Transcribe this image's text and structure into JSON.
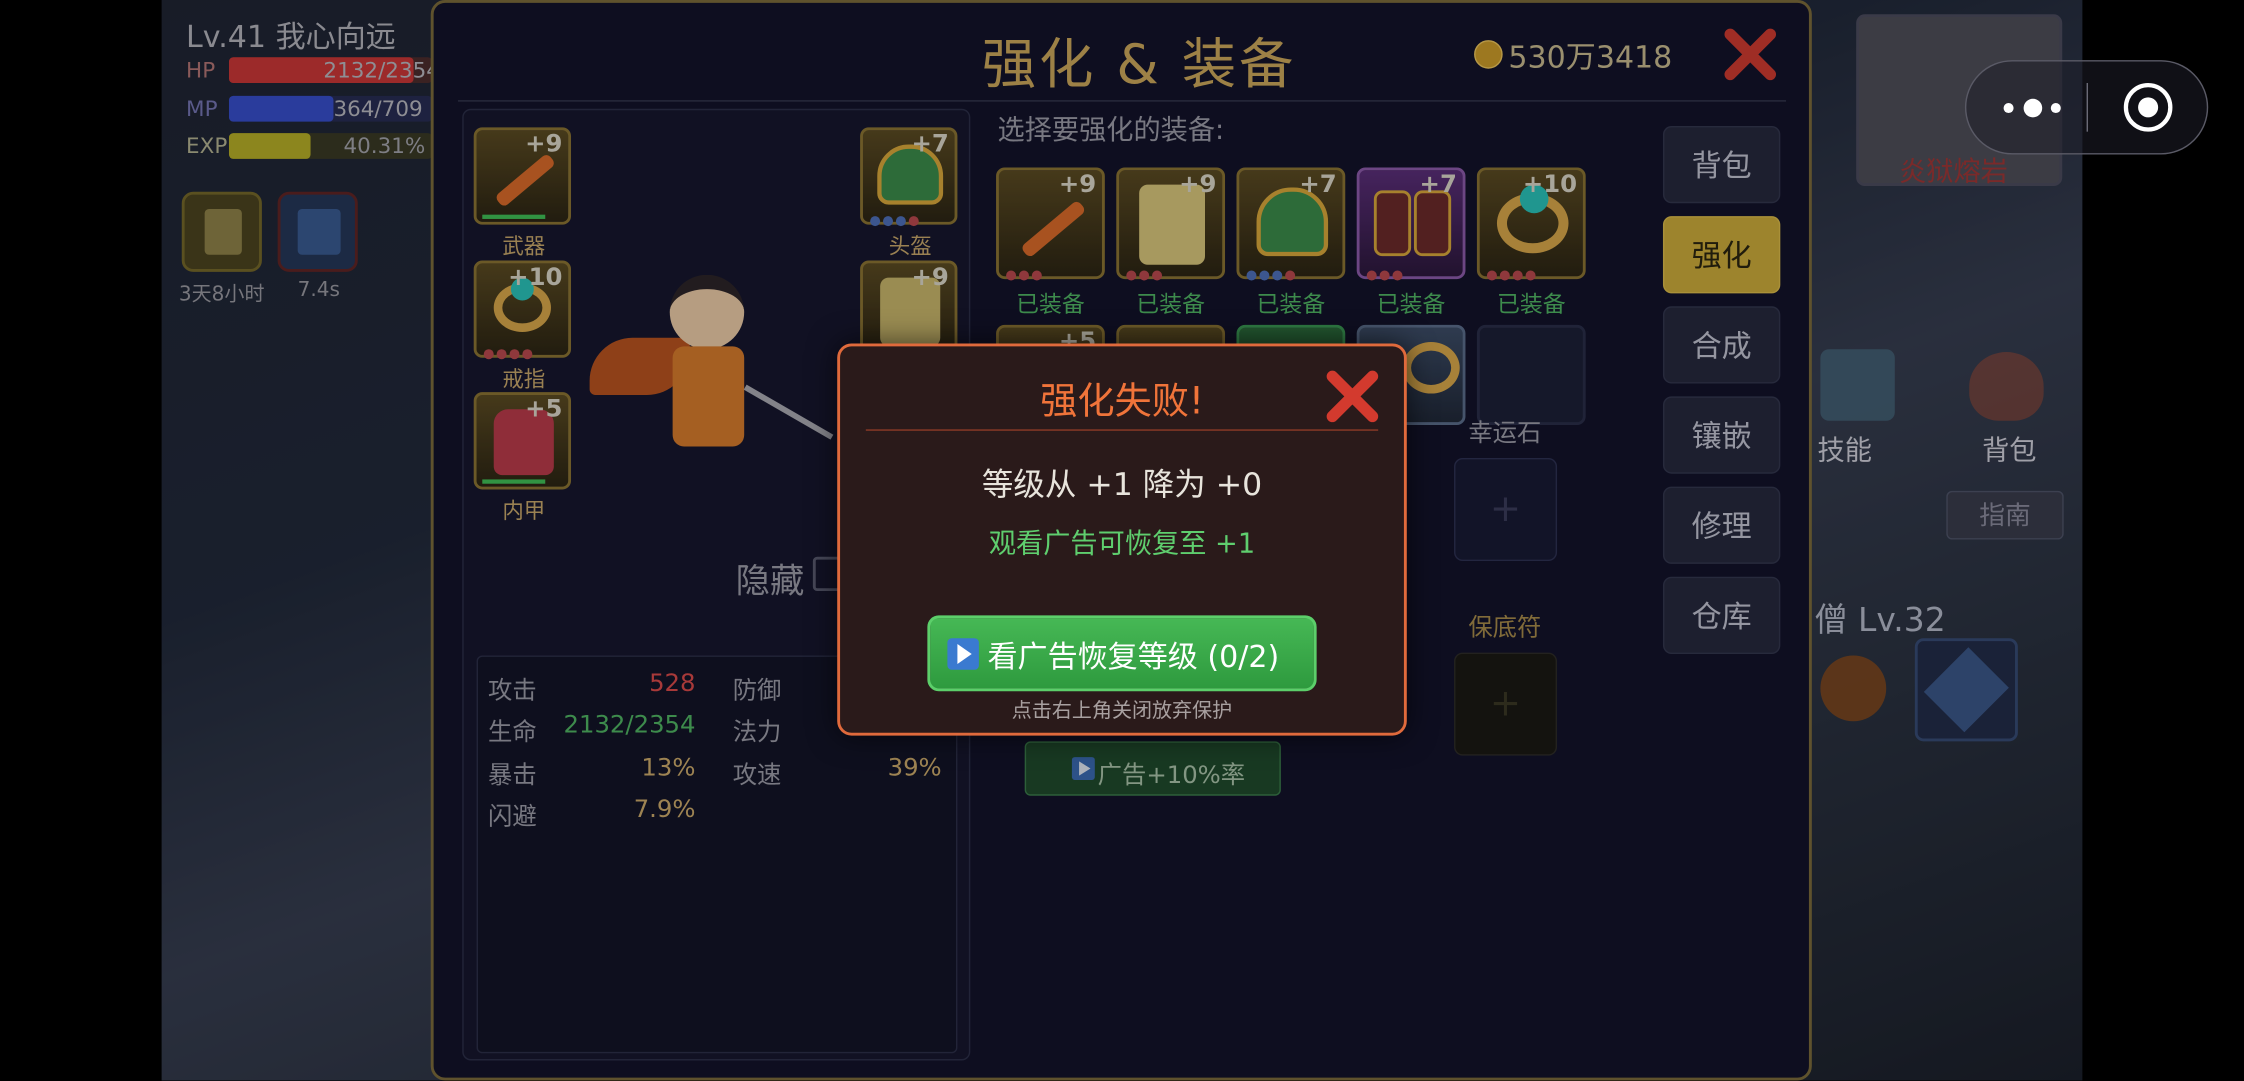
{
  "hud": {
    "player_name": "Lv.41 我心向远",
    "hp_label": "HP",
    "hp_value": "2132/2354",
    "hp_fraction": 0.906,
    "mp_label": "MP",
    "mp_value": "364/709",
    "mp_fraction": 0.513,
    "exp_label": "EXP",
    "exp_value": "40.31%",
    "exp_fraction": 0.4031,
    "buffs": [
      {
        "timer": "3天8小时"
      },
      {
        "timer": "7.4s"
      }
    ],
    "map_name": "炎狱熔岩",
    "right_skill_label": "技能",
    "right_bag_label": "背包",
    "guide_label": "指南",
    "monster_label": "僧 Lv.32"
  },
  "miniprogram": {
    "more_icon": "more-dots-icon",
    "close_icon": "target-circle-icon"
  },
  "panel": {
    "title": "强化 & 装备",
    "gold": "530万3418",
    "select_prompt": "选择要强化的装备:",
    "slots": [
      {
        "label": "武器",
        "level": "+9",
        "icon": "sword-icon"
      },
      {
        "label": "戒指",
        "level": "+10",
        "icon": "ring-icon"
      },
      {
        "label": "内甲",
        "level": "+5",
        "icon": "armor-icon"
      },
      {
        "label": "头盔",
        "level": "+7",
        "icon": "helmet-icon"
      },
      {
        "level": "+9",
        "icon": "robe-icon"
      }
    ],
    "hide_label": "隐藏",
    "stats": [
      {
        "name": "攻击",
        "value": "528",
        "color": "#e05050"
      },
      {
        "name": "防御",
        "value": ""
      },
      {
        "name": "生命",
        "value": "2132/2354",
        "color": "#4fc262"
      },
      {
        "name": "法力",
        "value": ""
      },
      {
        "name": "暴击",
        "value": "13%",
        "color": "#d9b56a"
      },
      {
        "name": "攻速",
        "value": "39%",
        "color": "#d9b56a"
      },
      {
        "name": "闪避",
        "value": "7.9%",
        "color": "#d9b56a"
      }
    ],
    "equipped_grid": [
      {
        "level": "+9",
        "status": "已装备",
        "icon": "sword-icon"
      },
      {
        "level": "+9",
        "status": "已装备",
        "icon": "robe-icon"
      },
      {
        "level": "+7",
        "status": "已装备",
        "icon": "helmet-icon"
      },
      {
        "level": "+7",
        "status": "已装备",
        "icon": "boots-icon"
      },
      {
        "level": "+10",
        "status": "已装备",
        "icon": "ring-icon"
      }
    ],
    "second_row": [
      {
        "level": "+5"
      },
      {},
      {},
      {},
      {}
    ],
    "lucky_stone_label": "幸运石",
    "protect_label": "保底符",
    "ad_rate_label": "广告+10%率",
    "nav": [
      "背包",
      "强化",
      "合成",
      "镶嵌",
      "修理",
      "仓库"
    ],
    "nav_active_index": 1
  },
  "dialog": {
    "title": "强化失败!",
    "level_change": "等级从 +1 降为 +0",
    "ad_hint": "观看广告可恢复至 +1",
    "button_label": "看广告恢复等级 (0/2)",
    "footer_hint": "点击右上角关闭放弃保护"
  },
  "colors": {
    "accent_gold": "#c9a93a",
    "dialog_border": "#e06a3c",
    "title_orange": "#f07a3c",
    "button_green": "#3fae4e"
  }
}
